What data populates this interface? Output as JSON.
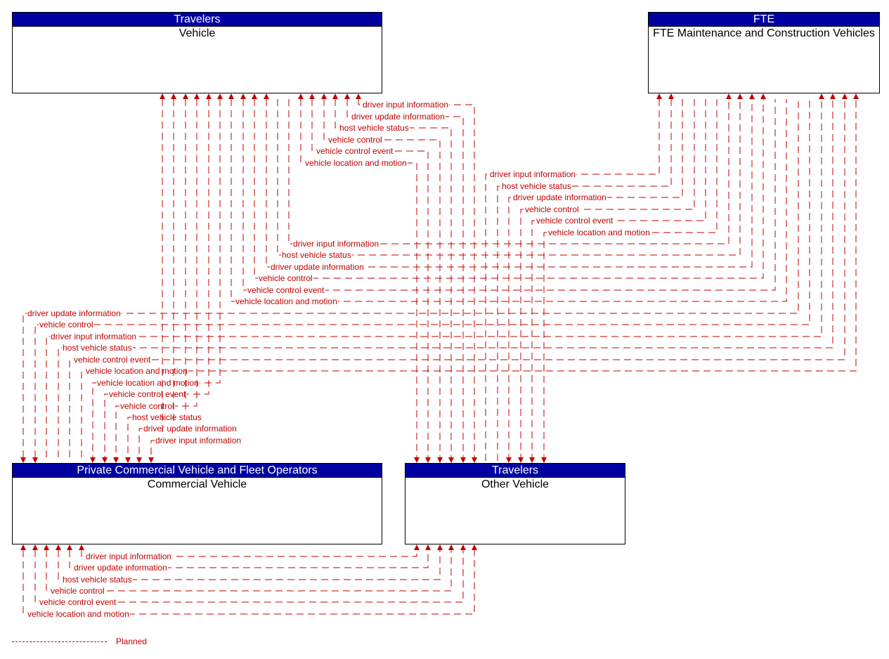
{
  "boxes": {
    "vehicle": {
      "header": "Travelers",
      "title": "Vehicle"
    },
    "fte": {
      "header": "FTE",
      "title": "FTE Maintenance and Construction Vehicles"
    },
    "commercial": {
      "header": "Private Commercial Vehicle and Fleet Operators",
      "title": "Commercial Vehicle"
    },
    "other": {
      "header": "Travelers",
      "title": "Other Vehicle"
    }
  },
  "flows": [
    {
      "group": "other-to-vehicle",
      "from": "Other Vehicle",
      "to": "Vehicle",
      "label": "driver input information",
      "status": "Planned"
    },
    {
      "group": "other-to-vehicle",
      "from": "Other Vehicle",
      "to": "Vehicle",
      "label": "driver update information",
      "status": "Planned"
    },
    {
      "group": "other-to-vehicle",
      "from": "Other Vehicle",
      "to": "Vehicle",
      "label": "host vehicle status",
      "status": "Planned"
    },
    {
      "group": "other-to-vehicle",
      "from": "Other Vehicle",
      "to": "Vehicle",
      "label": "vehicle control",
      "status": "Planned"
    },
    {
      "group": "other-to-vehicle",
      "from": "Other Vehicle",
      "to": "Vehicle",
      "label": "vehicle control event",
      "status": "Planned"
    },
    {
      "group": "other-to-vehicle",
      "from": "Other Vehicle",
      "to": "Vehicle",
      "label": "vehicle location and motion",
      "status": "Planned"
    },
    {
      "group": "fte-to-other",
      "from": "FTE Maintenance and Construction Vehicles",
      "to": "Other Vehicle",
      "label": "driver input information",
      "status": "Planned"
    },
    {
      "group": "fte-to-other",
      "from": "FTE Maintenance and Construction Vehicles",
      "to": "Other Vehicle",
      "label": "host vehicle status",
      "status": "Planned"
    },
    {
      "group": "fte-to-other",
      "from": "FTE Maintenance and Construction Vehicles",
      "to": "Other Vehicle",
      "label": "driver update information",
      "status": "Planned"
    },
    {
      "group": "fte-to-other",
      "from": "FTE Maintenance and Construction Vehicles",
      "to": "Other Vehicle",
      "label": "vehicle control",
      "status": "Planned"
    },
    {
      "group": "fte-to-other",
      "from": "FTE Maintenance and Construction Vehicles",
      "to": "Other Vehicle",
      "label": "vehicle control event",
      "status": "Planned"
    },
    {
      "group": "fte-to-other",
      "from": "FTE Maintenance and Construction Vehicles",
      "to": "Other Vehicle",
      "label": "vehicle location and motion",
      "status": "Planned"
    },
    {
      "group": "fte-to-vehicle",
      "from": "Vehicle",
      "to": "FTE Maintenance and Construction Vehicles",
      "label": "driver input information",
      "status": "Planned"
    },
    {
      "group": "fte-to-vehicle",
      "from": "Vehicle",
      "to": "FTE Maintenance and Construction Vehicles",
      "label": "host vehicle status",
      "status": "Planned"
    },
    {
      "group": "fte-to-vehicle",
      "from": "Vehicle",
      "to": "FTE Maintenance and Construction Vehicles",
      "label": "driver update information",
      "status": "Planned"
    },
    {
      "group": "fte-to-vehicle",
      "from": "Vehicle",
      "to": "FTE Maintenance and Construction Vehicles",
      "label": "vehicle control",
      "status": "Planned"
    },
    {
      "group": "fte-to-vehicle",
      "from": "Vehicle",
      "to": "FTE Maintenance and Construction Vehicles",
      "label": "vehicle control event",
      "status": "Planned"
    },
    {
      "group": "fte-to-vehicle",
      "from": "Vehicle",
      "to": "FTE Maintenance and Construction Vehicles",
      "label": "vehicle location and motion",
      "status": "Planned"
    },
    {
      "group": "fte-commercial",
      "from": "FTE Maintenance and Construction Vehicles",
      "to": "Commercial Vehicle",
      "label": "driver update information",
      "status": "Planned"
    },
    {
      "group": "fte-commercial",
      "from": "FTE Maintenance and Construction Vehicles",
      "to": "Commercial Vehicle",
      "label": "vehicle control",
      "status": "Planned"
    },
    {
      "group": "fte-commercial",
      "from": "Commercial Vehicle",
      "to": "FTE Maintenance and Construction Vehicles",
      "label": "driver input information",
      "status": "Planned"
    },
    {
      "group": "fte-commercial",
      "from": "Commercial Vehicle",
      "to": "FTE Maintenance and Construction Vehicles",
      "label": "host vehicle status",
      "status": "Planned"
    },
    {
      "group": "fte-commercial",
      "from": "Commercial Vehicle",
      "to": "FTE Maintenance and Construction Vehicles",
      "label": "vehicle control event",
      "status": "Planned"
    },
    {
      "group": "fte-commercial",
      "from": "Commercial Vehicle",
      "to": "FTE Maintenance and Construction Vehicles",
      "label": "vehicle location and motion",
      "status": "Planned"
    },
    {
      "group": "vehicle-commercial",
      "from": "Vehicle",
      "to": "Commercial Vehicle",
      "label": "vehicle location and motion",
      "status": "Planned"
    },
    {
      "group": "vehicle-commercial",
      "from": "Vehicle",
      "to": "Commercial Vehicle",
      "label": "vehicle control event",
      "status": "Planned"
    },
    {
      "group": "vehicle-commercial",
      "from": "Vehicle",
      "to": "Commercial Vehicle",
      "label": "vehicle control",
      "status": "Planned"
    },
    {
      "group": "vehicle-commercial",
      "from": "Vehicle",
      "to": "Commercial Vehicle",
      "label": "host vehicle status",
      "status": "Planned"
    },
    {
      "group": "vehicle-commercial",
      "from": "Vehicle",
      "to": "Commercial Vehicle",
      "label": "driver update information",
      "status": "Planned"
    },
    {
      "group": "vehicle-commercial",
      "from": "Vehicle",
      "to": "Commercial Vehicle",
      "label": "driver input information",
      "status": "Planned"
    },
    {
      "group": "other-to-commercial",
      "from": "Other Vehicle",
      "to": "Commercial Vehicle",
      "label": "driver input information",
      "status": "Planned"
    },
    {
      "group": "other-to-commercial",
      "from": "Other Vehicle",
      "to": "Commercial Vehicle",
      "label": "driver update information",
      "status": "Planned"
    },
    {
      "group": "other-to-commercial",
      "from": "Other Vehicle",
      "to": "Commercial Vehicle",
      "label": "host vehicle status",
      "status": "Planned"
    },
    {
      "group": "other-to-commercial",
      "from": "Other Vehicle",
      "to": "Commercial Vehicle",
      "label": "vehicle control",
      "status": "Planned"
    },
    {
      "group": "other-to-commercial",
      "from": "Other Vehicle",
      "to": "Commercial Vehicle",
      "label": "vehicle control event",
      "status": "Planned"
    },
    {
      "group": "other-to-commercial",
      "from": "Other Vehicle",
      "to": "Commercial Vehicle",
      "label": "vehicle location and motion",
      "status": "Planned"
    }
  ],
  "legend": {
    "label": "Planned"
  },
  "colors": {
    "flow": "#c00000",
    "header": "#0000a0"
  }
}
